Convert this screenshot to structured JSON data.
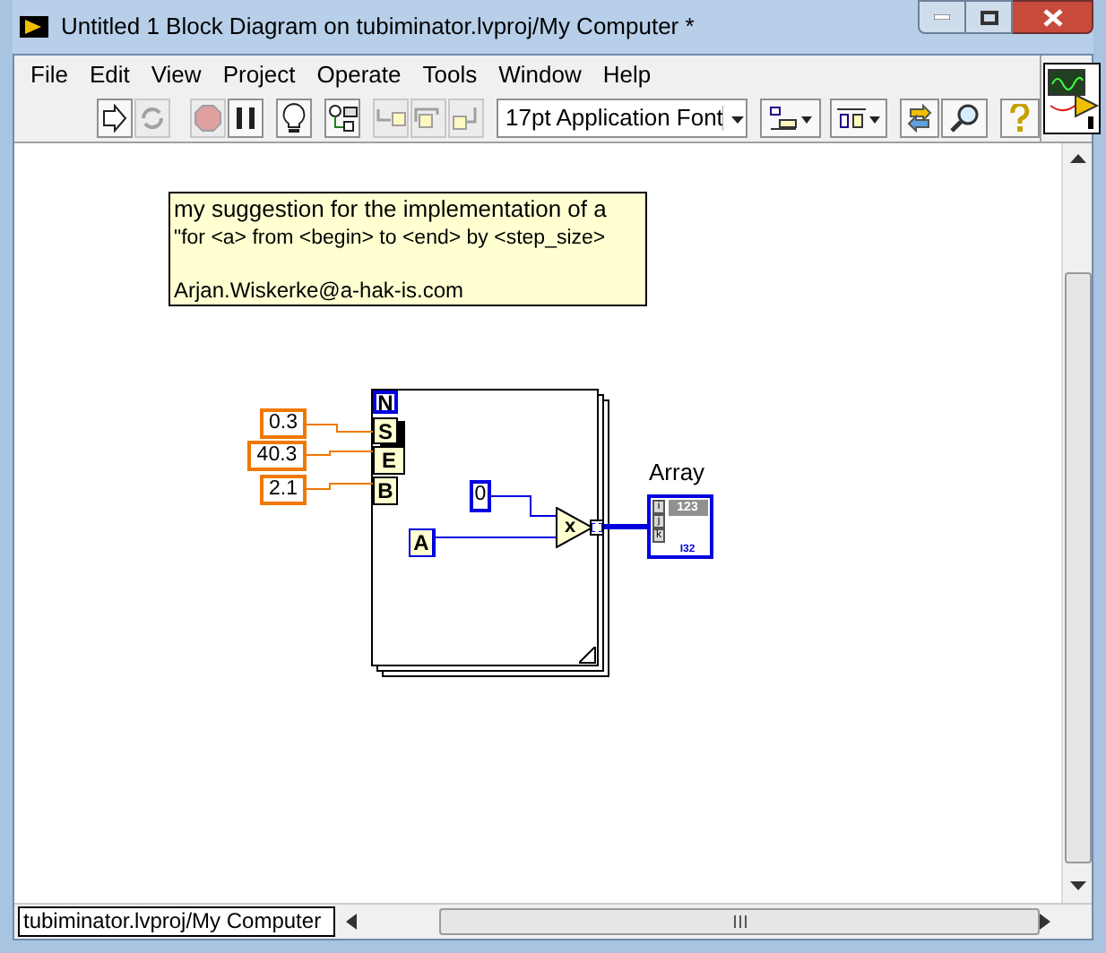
{
  "window": {
    "title": "Untitled 1 Block Diagram on tubiminator.lvproj/My Computer *"
  },
  "menu": [
    "File",
    "Edit",
    "View",
    "Project",
    "Operate",
    "Tools",
    "Window",
    "Help"
  ],
  "toolbar": [
    {
      "kind": "run",
      "disabled": false
    },
    {
      "kind": "run_continuously",
      "disabled": true
    },
    {
      "kind": "abort",
      "disabled": true
    },
    {
      "kind": "pause",
      "disabled": false
    },
    {
      "kind": "highlight",
      "disabled": false
    },
    {
      "kind": "retain",
      "disabled": false
    },
    {
      "kind": "step_into",
      "disabled": true
    },
    {
      "kind": "step_over",
      "disabled": true
    },
    {
      "kind": "step_out",
      "disabled": true
    }
  ],
  "font_dropdown": {
    "value": "17pt Application Font"
  },
  "comment": {
    "lines": [
      "my suggestion for the implementation of a",
      "\"for <a>  from <begin>  to <end> by <step_size>"
    ],
    "signature": "Arjan.Wiskerke@a-hak-is.com"
  },
  "diagram": {
    "constants": [
      "0.3",
      "40.3",
      "2.1"
    ],
    "terminals": [
      "N",
      "S",
      "E",
      "B"
    ],
    "zero_constant": "0",
    "input_terminal": "A",
    "multiply_symbol": "x",
    "array": {
      "label": "Array",
      "value": "123",
      "indices": [
        "i",
        "j",
        "k"
      ],
      "type": "I32"
    }
  },
  "status_bar": {
    "path": "tubiminator.lvproj/My Computer"
  }
}
